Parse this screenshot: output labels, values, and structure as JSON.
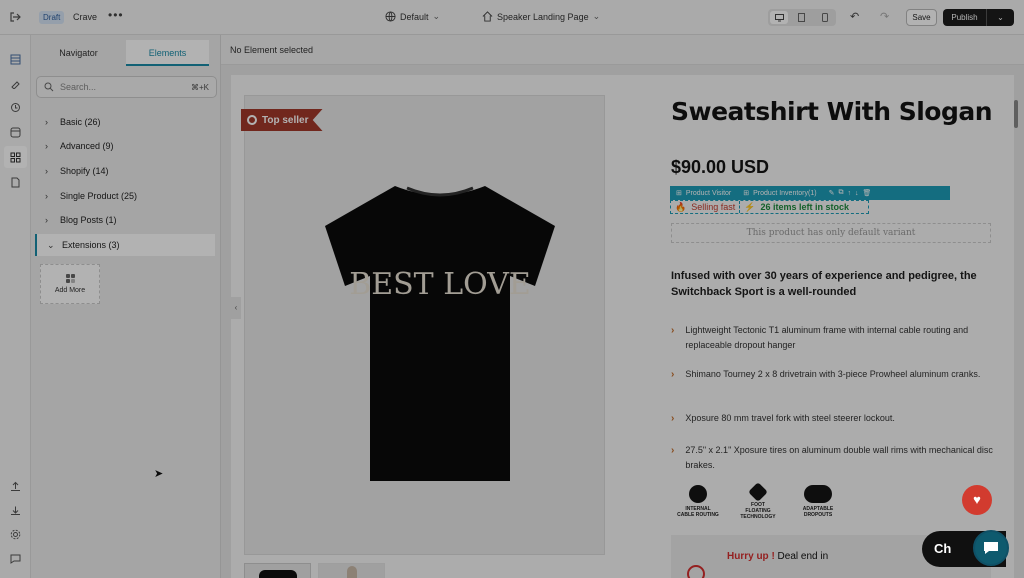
{
  "topbar": {
    "status": "Draft",
    "store": "Crave",
    "more": "•••",
    "device": "Default",
    "page": "Speaker Landing Page",
    "save": "Save",
    "publish": "Publish"
  },
  "panel": {
    "tabs": [
      "Navigator",
      "Elements"
    ],
    "search_placeholder": "Search...",
    "search_shortcut": "⌘+K",
    "categories": [
      {
        "label": "Basic (26)"
      },
      {
        "label": "Advanced (9)"
      },
      {
        "label": "Shopify (14)"
      },
      {
        "label": "Single Product (25)"
      },
      {
        "label": "Blog Posts (1)"
      },
      {
        "label": "Extensions (3)"
      }
    ],
    "add_more": "Add More"
  },
  "canvas": {
    "status": "No Element selected"
  },
  "product": {
    "badge": "Top seller",
    "shirt_text": "BEST LOVE",
    "title": "Sweatshirt With Slogan",
    "price": "$90.00 USD",
    "toolbar": [
      "Product Visitor",
      "Product Inventory(1)"
    ],
    "selling": "Selling fast",
    "stock": "26 items left in stock",
    "variant": "This product has only default variant",
    "description": "Infused with over 30 years of experience and pedigree, the Switchback Sport is a well-rounded",
    "features": [
      "Lightweight Tectonic T1 aluminum frame with internal cable routing and replaceable dropout hanger",
      "Shimano Tourney 2 x 8 drivetrain with 3-piece Prowheel aluminum cranks.",
      "Xposure 80 mm travel fork with steel steerer lockout.",
      "27.5\" x 2.1\" Xposure tires on aluminum double wall rims with mechanical disc brakes."
    ],
    "logos": [
      {
        "label": "INTERNAL",
        "sub": "CABLE ROUTING"
      },
      {
        "label": "FOOT",
        "sub": "FLOATING TECHNOLOGY"
      },
      {
        "label": "ADAPTABLE",
        "sub": "DROPOUTS"
      }
    ],
    "hurry": "Hurry up !",
    "deal": " Deal end in"
  },
  "widgets": {
    "chat": "Ch",
    "heart": "♥"
  }
}
